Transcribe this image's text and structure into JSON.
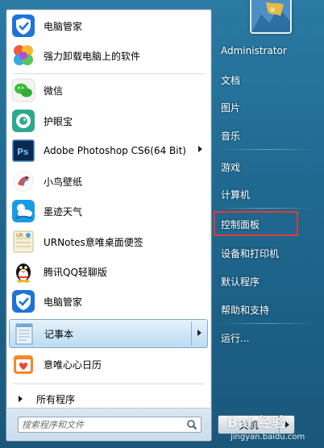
{
  "pinned_apps": [
    {
      "label": "电脑管家",
      "icon": "tencent-pc-manager-icon",
      "has_submenu": false
    },
    {
      "label": "强力卸载电脑上的软件",
      "icon": "uninstaller-icon",
      "has_submenu": false
    }
  ],
  "recent_apps": [
    {
      "label": "微信",
      "icon": "wechat-icon",
      "has_submenu": false
    },
    {
      "label": "护眼宝",
      "icon": "eye-protector-icon",
      "has_submenu": false
    },
    {
      "label": "Adobe Photoshop CS6(64 Bit)",
      "icon": "photoshop-icon",
      "has_submenu": true
    },
    {
      "label": "小鸟壁纸",
      "icon": "bird-wallpaper-icon",
      "has_submenu": false
    },
    {
      "label": "墨迹天气",
      "icon": "moji-weather-icon",
      "has_submenu": false
    },
    {
      "label": "URNotes意唯桌面便签",
      "icon": "urnotes-icon",
      "has_submenu": false
    },
    {
      "label": "腾讯QQ轻聊版",
      "icon": "qq-penguin-icon",
      "has_submenu": false
    },
    {
      "label": "电脑管家",
      "icon": "tencent-pc-manager-icon",
      "has_submenu": false
    },
    {
      "label": "记事本",
      "icon": "notepad-icon",
      "has_submenu": true,
      "selected": true
    },
    {
      "label": "意唯心心日历",
      "icon": "calendar-heart-icon",
      "has_submenu": false
    }
  ],
  "all_programs": {
    "label": "所有程序"
  },
  "search": {
    "placeholder": "搜索程序和文件"
  },
  "right_menu": {
    "user": "Administrator",
    "items": [
      "文档",
      "图片",
      "音乐",
      "游戏",
      "计算机",
      "控制面板",
      "设备和打印机",
      "默认程序",
      "帮助和支持",
      "运行..."
    ],
    "highlighted_item": "控制面板"
  },
  "shutdown": {
    "label": "关机"
  },
  "watermark": {
    "main": "Bai 经验",
    "sub": "jingyan.baidu.com"
  },
  "colors": {
    "highlight_box": "#e03a2e",
    "selected_bg": "#cfe6f6",
    "pane_bg": "#ffffff",
    "frame_blue": "#1f6890"
  }
}
